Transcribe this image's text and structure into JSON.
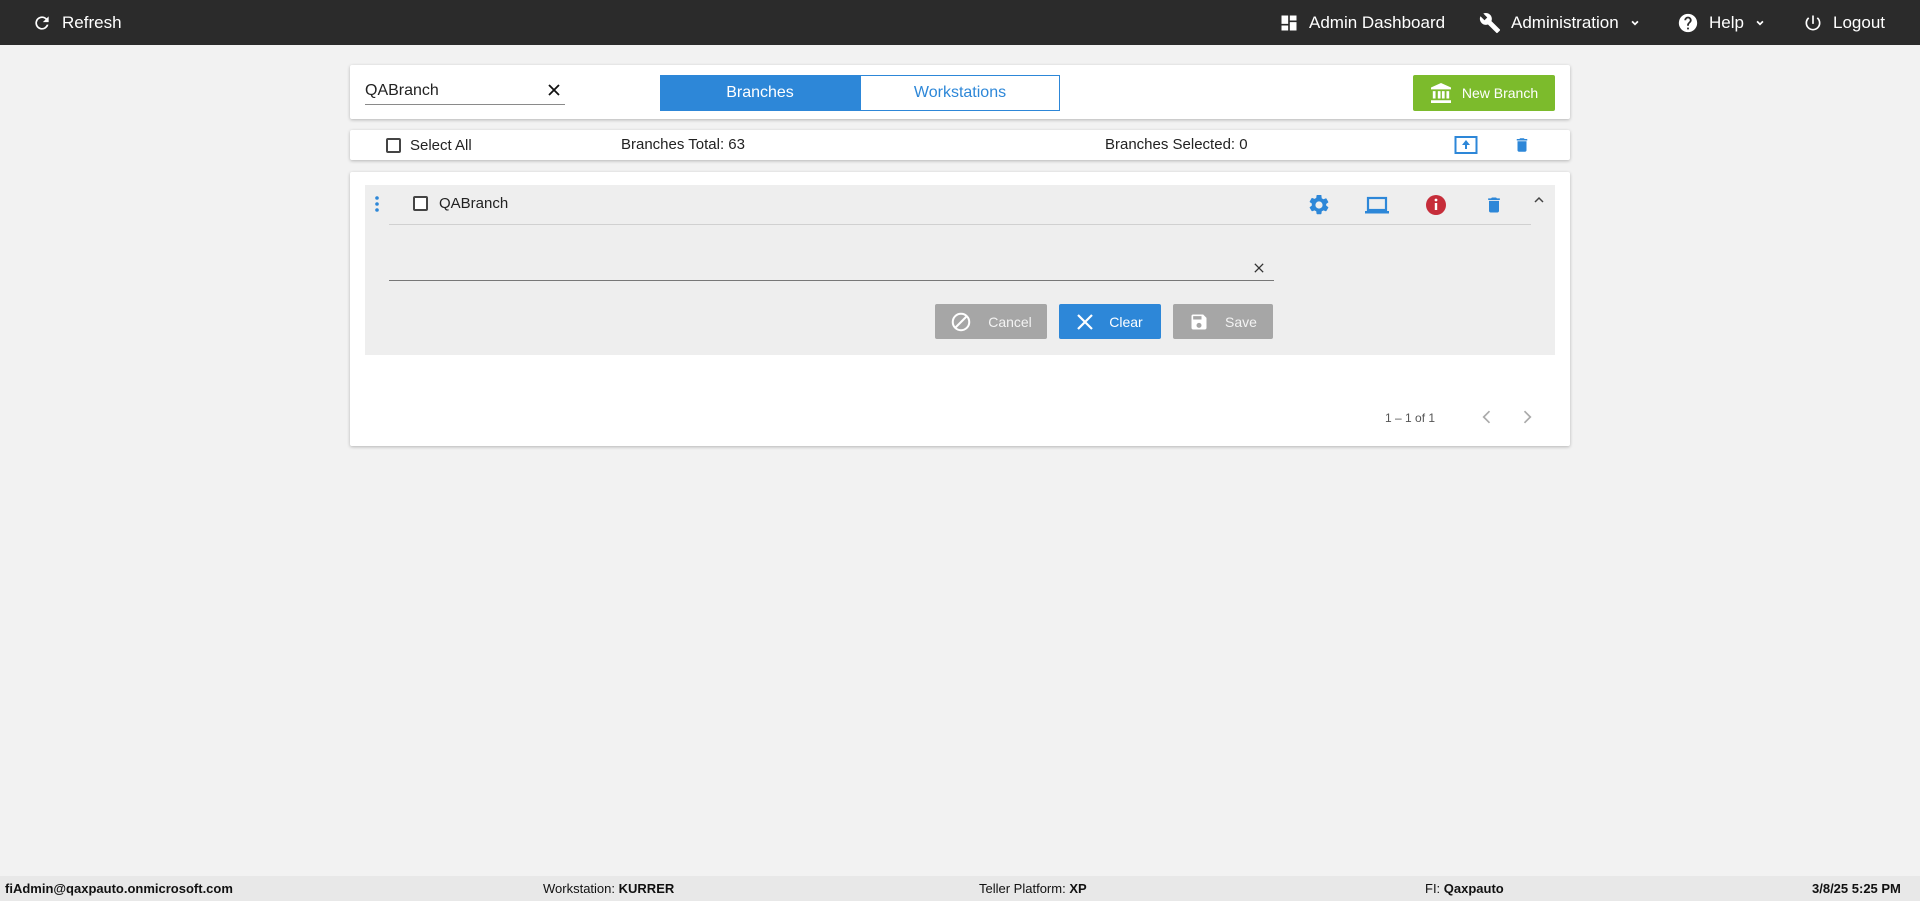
{
  "topbar": {
    "refresh_label": "Refresh",
    "dashboard_label": "Admin Dashboard",
    "administration_label": "Administration",
    "help_label": "Help",
    "logout_label": "Logout"
  },
  "search": {
    "value": "QABranch",
    "tabs": [
      {
        "label": "Branches",
        "active": true
      },
      {
        "label": "Workstations",
        "active": false
      }
    ],
    "new_branch_label": "New Branch"
  },
  "selection": {
    "select_all_label": "Select All",
    "total_label": "Branches Total: 63",
    "selected_label": "Branches Selected: 0"
  },
  "branches": [
    {
      "name": "QABranch",
      "edit_value": "",
      "actions": {
        "cancel_label": "Cancel",
        "clear_label": "Clear",
        "save_label": "Save"
      }
    }
  ],
  "pagination": {
    "range_label": "1 – 1 of 1"
  },
  "status": {
    "user": "fiAdmin@qaxpauto.onmicrosoft.com",
    "workstation_label": "Workstation:",
    "workstation_value": "KURRER",
    "platform_label": "Teller Platform:",
    "platform_value": "XP",
    "fi_label": "FI:",
    "fi_value": "Qaxpauto",
    "datetime": "3/8/25 5:25 PM"
  },
  "colors": {
    "accent_blue": "#2d87d8",
    "new_branch_green": "#7cbb2c",
    "info_red": "#c62d3a",
    "topbar_bg": "#2b2b2b"
  }
}
